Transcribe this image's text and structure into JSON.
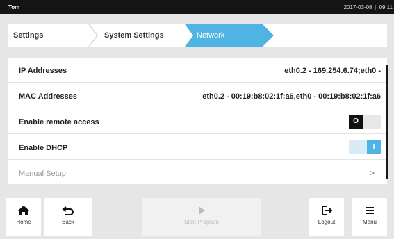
{
  "statusbar": {
    "user": "Tom",
    "date": "2017-03-08",
    "time": "09:11"
  },
  "breadcrumb": {
    "items": [
      "Settings",
      "System Settings",
      "Network"
    ]
  },
  "rows": [
    {
      "label": "IP Addresses",
      "value": "eth0.2 - 169.254.6.74;eth0 -"
    },
    {
      "label": "MAC Addresses",
      "value": "eth0.2 - 00:19:b8:02:1f:a6,eth0 - 00:19:b8:02:1f:a6"
    },
    {
      "label": "Enable remote access",
      "toggle_state": "off",
      "toggle_glyph": "O"
    },
    {
      "label": "Enable DHCP",
      "toggle_state": "on",
      "toggle_glyph": "I"
    },
    {
      "label": "Manual Setup",
      "arrow": ">"
    }
  ],
  "toolbar": {
    "home_label": "Home",
    "back_label": "Back",
    "start_label": "Start Program",
    "logout_label": "Logout",
    "menu_label": "Menu"
  },
  "colors": {
    "accent": "#4fb4e4",
    "statusbar_bg": "#141414",
    "page_bg": "#e6e6e6"
  },
  "icons": [
    "home-icon",
    "back-arrow-icon",
    "play-icon",
    "logout-icon",
    "menu-icon",
    "chevron-right-icon"
  ]
}
